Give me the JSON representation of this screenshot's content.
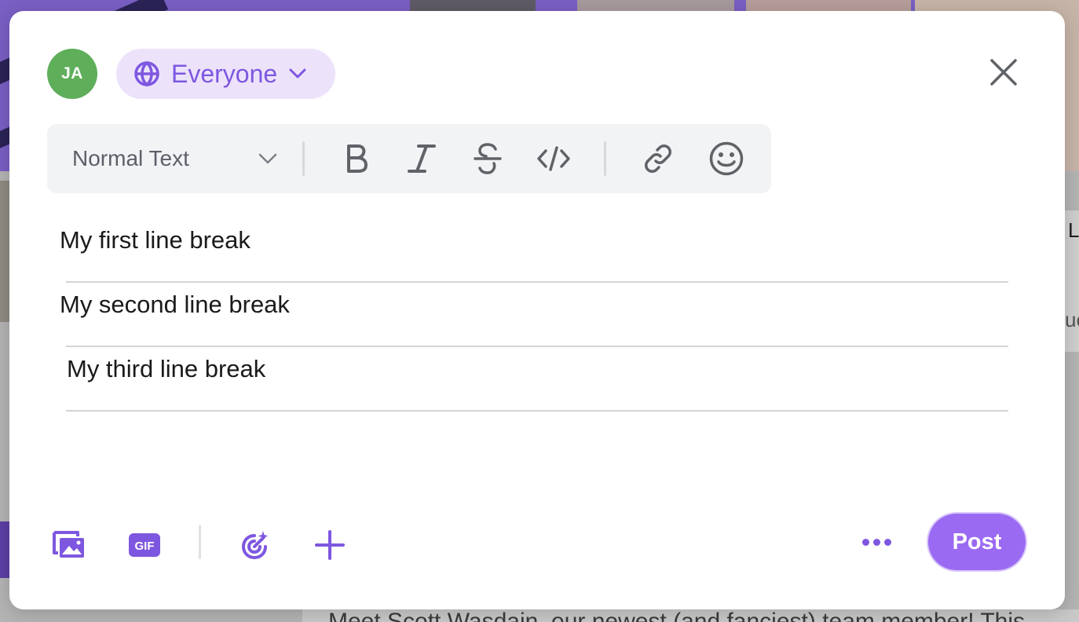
{
  "composer": {
    "avatar_initials": "JA",
    "audience_label": "Everyone",
    "toolbar": {
      "text_style": "Normal Text",
      "buttons": [
        "bold-icon",
        "italic-icon",
        "strikethrough-icon",
        "code-icon",
        "link-icon",
        "emoji-icon"
      ]
    },
    "lines": [
      "My first line break",
      "My second line break",
      "My third line break"
    ],
    "actions": [
      "media-icon",
      "gif-icon",
      "target-icon",
      "plus-icon",
      "more-icon"
    ],
    "gif_label": "GIF",
    "post_label": "Post"
  },
  "background": {
    "right_text_top": "L",
    "right_text_mid": "ue",
    "bottom_text": "Meet Scott Wasdain, our newest (and fanciest) team member! This"
  },
  "colors": {
    "accent": "#7e57e0",
    "post_button": "#9b6af2",
    "audience_bg": "#ece3fb",
    "avatar_bg": "#5fae5a",
    "toolbar_bg": "#f2f3f5"
  }
}
